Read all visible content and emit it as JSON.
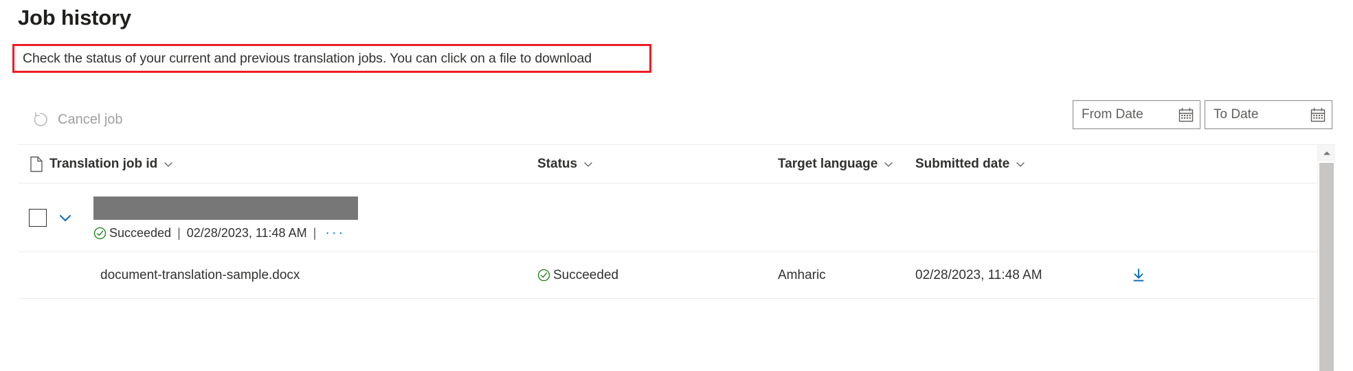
{
  "page": {
    "title": "Job history",
    "description": "Check the status of your current and previous translation jobs. You can click on a file to download",
    "highlight_color": "#ee1c25"
  },
  "command_bar": {
    "cancel_job": {
      "label": "Cancel job",
      "icon": "cancel-circle-arrow-icon",
      "disabled": true
    },
    "from_date": {
      "value": "",
      "placeholder": "From Date",
      "icon": "calendar-icon"
    },
    "to_date": {
      "value": "",
      "placeholder": "To Date",
      "icon": "calendar-icon"
    }
  },
  "table": {
    "columns": [
      {
        "key": "name",
        "label": "Translation job id",
        "icon": "document-icon",
        "sort_icon": "chevron-down-icon"
      },
      {
        "key": "status",
        "label": "Status",
        "sort_icon": "chevron-down-icon"
      },
      {
        "key": "language",
        "label": "Target language",
        "sort_icon": "chevron-down-icon"
      },
      {
        "key": "submitted",
        "label": "Submitted date",
        "sort_icon": "chevron-down-icon"
      }
    ],
    "group": {
      "selected": false,
      "expanded": true,
      "job_id_redacted": true,
      "status": "Succeeded",
      "status_icon": "success-check-icon",
      "status_color": "#107c10",
      "separator": "|",
      "submitted": "02/28/2023, 11:48 AM",
      "overflow_label": "···"
    },
    "rows": [
      {
        "name": "document-translation-sample.docx",
        "status": "Succeeded",
        "status_icon": "success-check-icon",
        "language": "Amharic",
        "submitted": "02/28/2023, 11:48 AM",
        "action_icon": "download-icon",
        "action_color": "#0f6cbd"
      }
    ]
  },
  "scrollbar": {
    "up_arrow_icon": "scroll-up-arrow-icon",
    "position": "top"
  }
}
